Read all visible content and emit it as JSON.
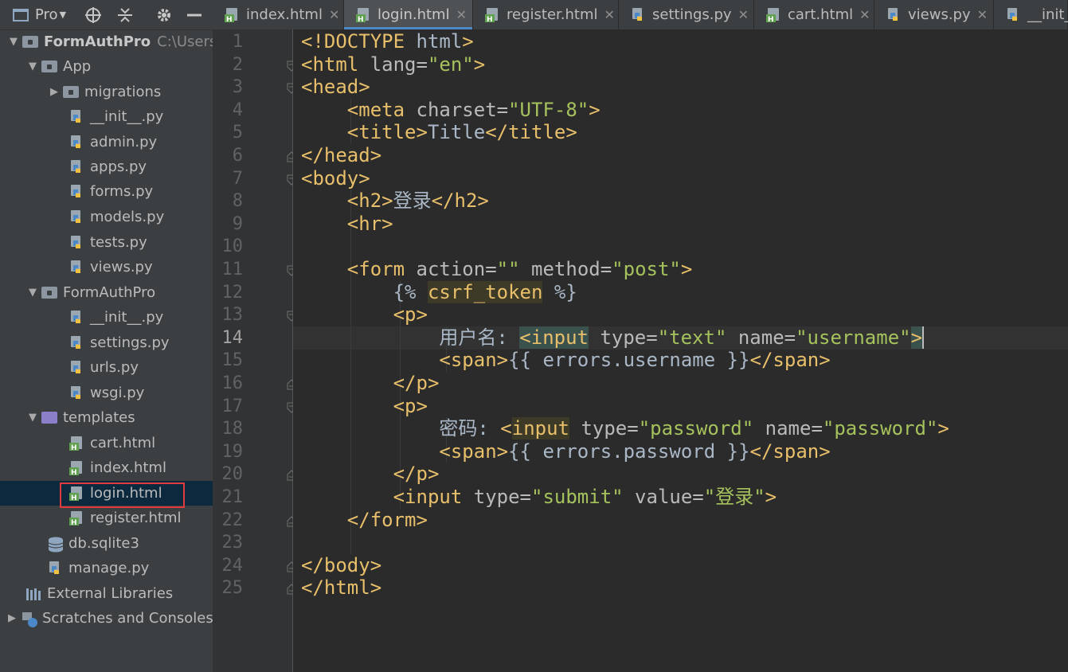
{
  "toolbar": {
    "project_label": "Pro"
  },
  "project": {
    "root_name": "FormAuthPro",
    "root_path": "C:\\Users\\",
    "items": [
      {
        "label": "App"
      },
      {
        "label": "migrations"
      },
      {
        "label": "__init__.py"
      },
      {
        "label": "admin.py"
      },
      {
        "label": "apps.py"
      },
      {
        "label": "forms.py"
      },
      {
        "label": "models.py"
      },
      {
        "label": "tests.py"
      },
      {
        "label": "views.py"
      },
      {
        "label": "FormAuthPro"
      },
      {
        "label": "__init__.py"
      },
      {
        "label": "settings.py"
      },
      {
        "label": "urls.py"
      },
      {
        "label": "wsgi.py"
      },
      {
        "label": "templates"
      },
      {
        "label": "cart.html"
      },
      {
        "label": "index.html"
      },
      {
        "label": "login.html"
      },
      {
        "label": "register.html"
      },
      {
        "label": "db.sqlite3"
      },
      {
        "label": "manage.py"
      },
      {
        "label": "External Libraries"
      },
      {
        "label": "Scratches and Consoles"
      }
    ]
  },
  "tabs": [
    {
      "label": "index.html"
    },
    {
      "label": "login.html"
    },
    {
      "label": "register.html"
    },
    {
      "label": "settings.py"
    },
    {
      "label": "cart.html"
    },
    {
      "label": "views.py"
    },
    {
      "label": "__init_"
    }
  ],
  "editor": {
    "line_numbers": [
      "1",
      "2",
      "3",
      "4",
      "5",
      "6",
      "7",
      "8",
      "9",
      "10",
      "11",
      "12",
      "13",
      "14",
      "15",
      "16",
      "17",
      "18",
      "19",
      "20",
      "21",
      "22",
      "23",
      "24",
      "25"
    ],
    "current_line": "14",
    "lines": [
      "<!DOCTYPE html>",
      "<html lang=\"en\">",
      "<head>",
      "    <meta charset=\"UTF-8\">",
      "    <title>Title</title>",
      "</head>",
      "<body>",
      "    <h2>登录</h2>",
      "    <hr>",
      "",
      "    <form action=\"\" method=\"post\">",
      "        {% csrf_token %}",
      "        <p>",
      "            用户名: <input type=\"text\" name=\"username\">",
      "            <span>{{ errors.username }}</span>",
      "        </p>",
      "        <p>",
      "            密码: <input type=\"password\" name=\"password\">",
      "            <span>{{ errors.password }}</span>",
      "        </p>",
      "        <input type=\"submit\" value=\"登录\">",
      "    </form>",
      "",
      "</body>",
      "</html>"
    ]
  },
  "colors": {
    "tag": "#e8bf6a",
    "attr": "#bababa",
    "string": "#a5c25c",
    "text": "#a9b7c6",
    "selection_box": "#e0393e"
  }
}
